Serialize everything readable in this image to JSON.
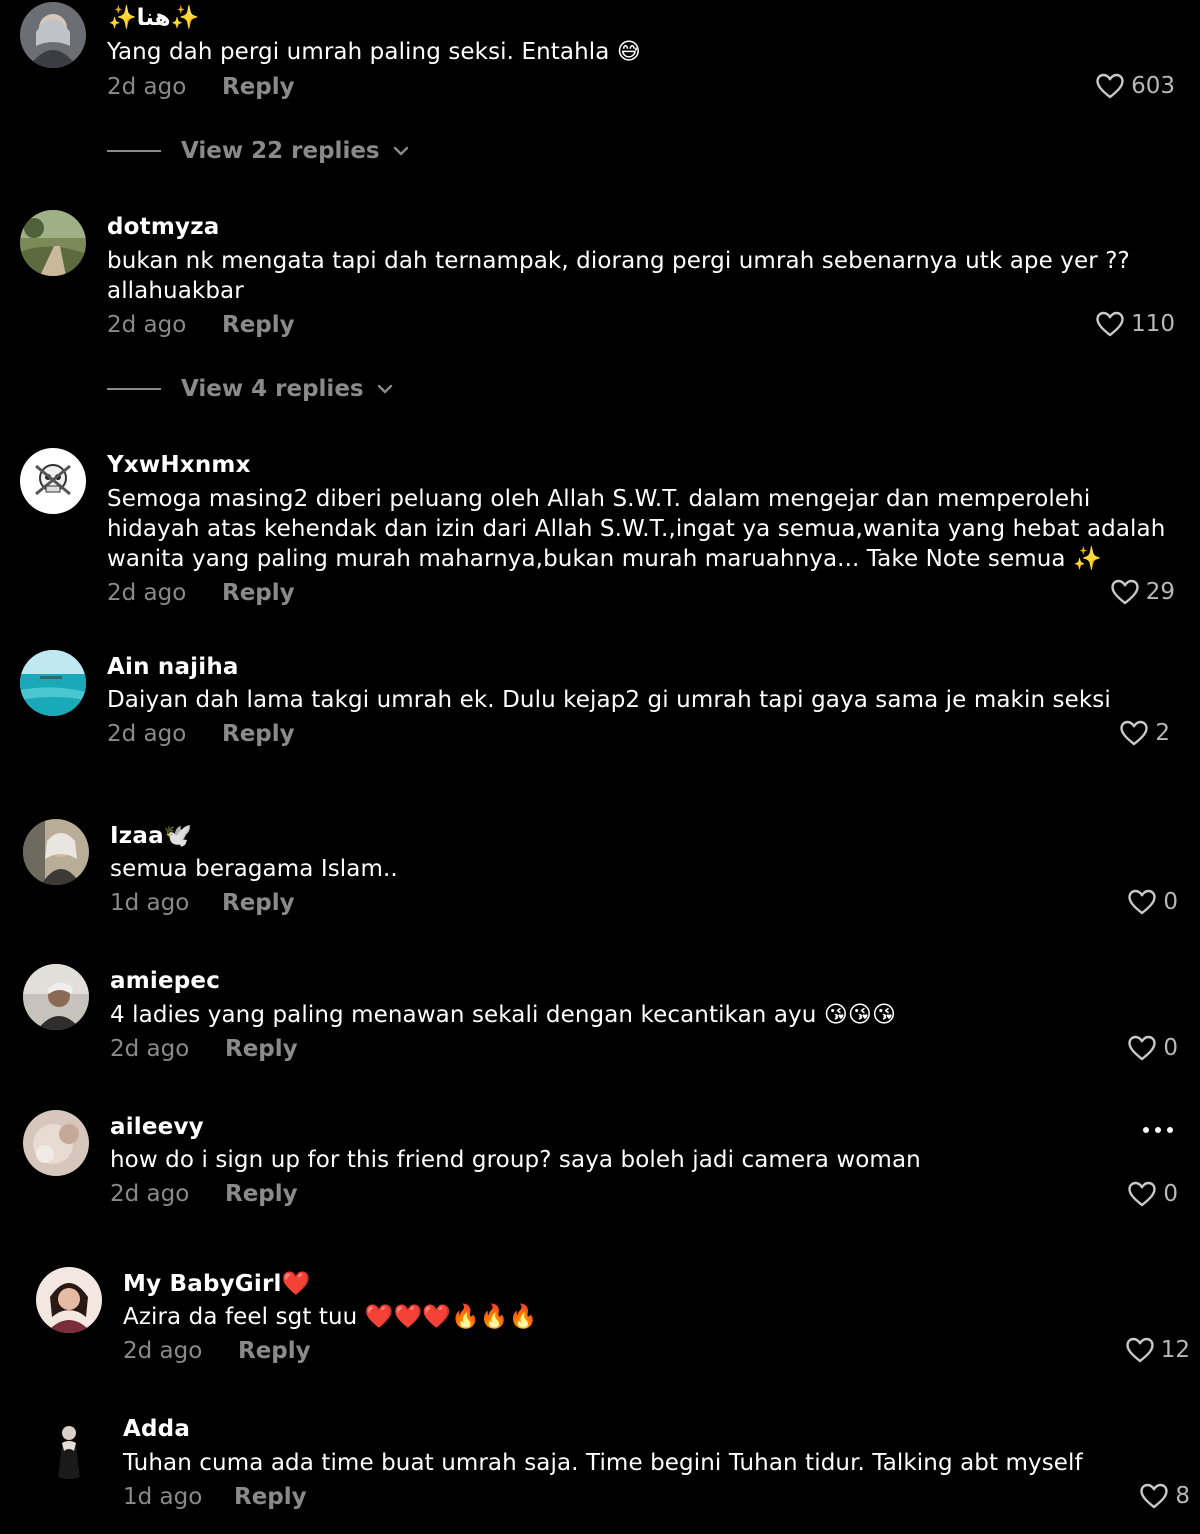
{
  "comments": [
    {
      "username": "✨هنا✨",
      "text": "Yang dah pergi umrah paling seksi. Entahla 😅",
      "time": "2d ago",
      "reply": "Reply",
      "likes": "603",
      "view_replies": "View 22 replies"
    },
    {
      "username": "dotmyza",
      "text": "bukan nk mengata tapi dah ternampak, diorang pergi umrah sebenarnya utk ape yer ?? allahuakbar",
      "time": "2d ago",
      "reply": "Reply",
      "likes": "110",
      "view_replies": "View 4 replies"
    },
    {
      "username": "YxwHxnmx",
      "text": "Semoga masing2 diberi peluang oleh Allah S.W.T. dalam mengejar dan memperolehi hidayah atas kehendak dan izin dari Allah S.W.T.,ingat ya semua,wanita yang hebat adalah wanita yang paling murah maharnya,bukan murah maruahnya... Take Note semua ✨",
      "time": "2d ago",
      "reply": "Reply",
      "likes": "29"
    },
    {
      "username": "Ain najiha",
      "text": "Daiyan dah lama takgi umrah ek. Dulu kejap2 gi umrah tapi gaya sama je makin seksi",
      "time": "2d ago",
      "reply": "Reply",
      "likes": "2"
    },
    {
      "username": "Izaa🕊️",
      "text": "semua beragama Islam..",
      "time": "1d ago",
      "reply": "Reply",
      "likes": "0"
    },
    {
      "username": "amiepec",
      "text": "4 ladies yang paling menawan sekali dengan kecantikan ayu 😘😘😘",
      "time": "2d ago",
      "reply": "Reply",
      "likes": "0"
    },
    {
      "username": "aileevy",
      "text": "how do i sign up for this friend group? saya boleh jadi camera woman",
      "time": "2d ago",
      "reply": "Reply",
      "likes": "0"
    },
    {
      "username": "My BabyGirl❤️",
      "text": "Azira da feel sgt tuu ❤️❤️❤️🔥🔥🔥",
      "time": "2d ago",
      "reply": "Reply",
      "likes": "12"
    },
    {
      "username": "Adda",
      "text": "Tuhan cuma ada time buat umrah saja. Time begini Tuhan tidur. Talking abt myself",
      "time": "1d ago",
      "reply": "Reply",
      "likes": "8"
    }
  ],
  "icons": {
    "like": "heart-outline-icon",
    "expand": "chevron-down-icon",
    "more": "more-horizontal-icon"
  },
  "colors": {
    "background": "#000000",
    "primary_text": "#ffffff",
    "secondary_text": "#8a8a8a"
  }
}
